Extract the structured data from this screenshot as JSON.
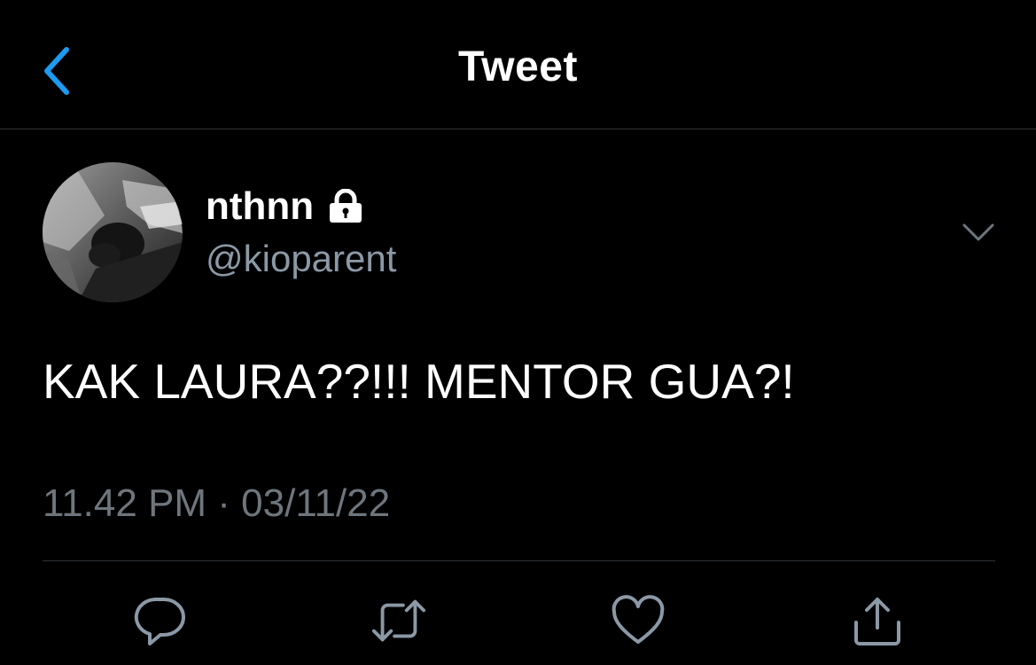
{
  "header": {
    "title": "Tweet",
    "back_icon": "chevron-left-icon",
    "accent_color": "#1d9bf0"
  },
  "author": {
    "display_name": "nthnn",
    "handle": "@kioparent",
    "protected_icon": "lock-icon",
    "avatar": "avatar-photo"
  },
  "tweet": {
    "text": "KAK LAURA??!!! MENTOR GUA?!",
    "timestamp": "11.42 PM · 03/11/22"
  },
  "actions": {
    "icons": [
      "reply-icon",
      "retweet-icon",
      "like-icon",
      "share-icon"
    ],
    "icon_color": "#8b98a5"
  },
  "colors": {
    "background": "#000000",
    "text": "#ffffff",
    "secondary_text": "#8b98a5",
    "divider": "#2f3336"
  }
}
